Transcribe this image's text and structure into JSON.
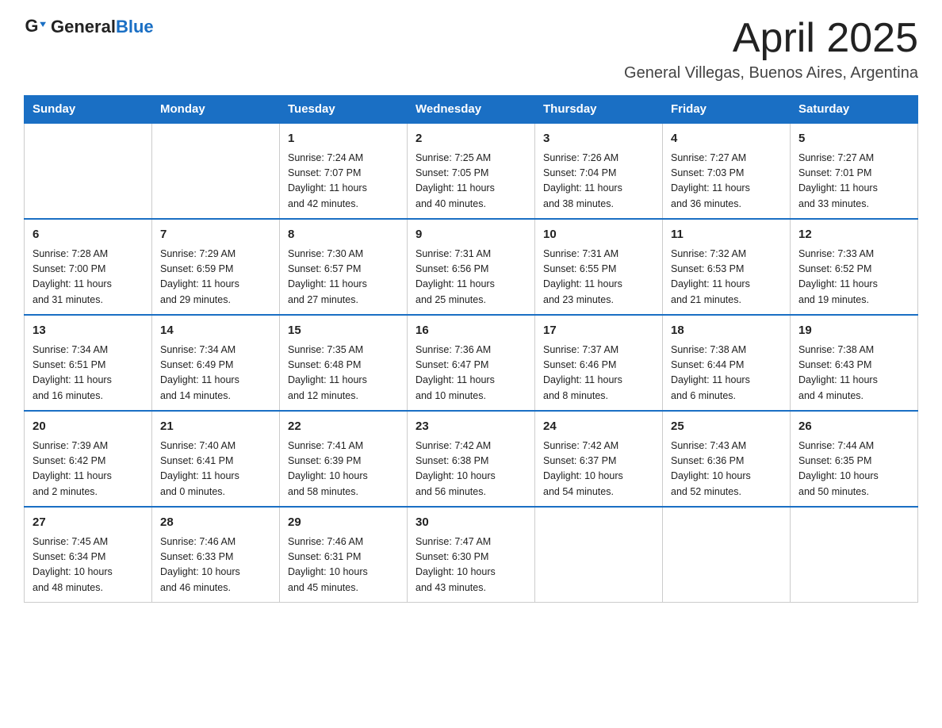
{
  "header": {
    "logo_general": "General",
    "logo_blue": "Blue",
    "month_title": "April 2025",
    "location": "General Villegas, Buenos Aires, Argentina"
  },
  "days_of_week": [
    "Sunday",
    "Monday",
    "Tuesday",
    "Wednesday",
    "Thursday",
    "Friday",
    "Saturday"
  ],
  "weeks": [
    [
      {
        "num": "",
        "detail": ""
      },
      {
        "num": "",
        "detail": ""
      },
      {
        "num": "1",
        "detail": "Sunrise: 7:24 AM\nSunset: 7:07 PM\nDaylight: 11 hours\nand 42 minutes."
      },
      {
        "num": "2",
        "detail": "Sunrise: 7:25 AM\nSunset: 7:05 PM\nDaylight: 11 hours\nand 40 minutes."
      },
      {
        "num": "3",
        "detail": "Sunrise: 7:26 AM\nSunset: 7:04 PM\nDaylight: 11 hours\nand 38 minutes."
      },
      {
        "num": "4",
        "detail": "Sunrise: 7:27 AM\nSunset: 7:03 PM\nDaylight: 11 hours\nand 36 minutes."
      },
      {
        "num": "5",
        "detail": "Sunrise: 7:27 AM\nSunset: 7:01 PM\nDaylight: 11 hours\nand 33 minutes."
      }
    ],
    [
      {
        "num": "6",
        "detail": "Sunrise: 7:28 AM\nSunset: 7:00 PM\nDaylight: 11 hours\nand 31 minutes."
      },
      {
        "num": "7",
        "detail": "Sunrise: 7:29 AM\nSunset: 6:59 PM\nDaylight: 11 hours\nand 29 minutes."
      },
      {
        "num": "8",
        "detail": "Sunrise: 7:30 AM\nSunset: 6:57 PM\nDaylight: 11 hours\nand 27 minutes."
      },
      {
        "num": "9",
        "detail": "Sunrise: 7:31 AM\nSunset: 6:56 PM\nDaylight: 11 hours\nand 25 minutes."
      },
      {
        "num": "10",
        "detail": "Sunrise: 7:31 AM\nSunset: 6:55 PM\nDaylight: 11 hours\nand 23 minutes."
      },
      {
        "num": "11",
        "detail": "Sunrise: 7:32 AM\nSunset: 6:53 PM\nDaylight: 11 hours\nand 21 minutes."
      },
      {
        "num": "12",
        "detail": "Sunrise: 7:33 AM\nSunset: 6:52 PM\nDaylight: 11 hours\nand 19 minutes."
      }
    ],
    [
      {
        "num": "13",
        "detail": "Sunrise: 7:34 AM\nSunset: 6:51 PM\nDaylight: 11 hours\nand 16 minutes."
      },
      {
        "num": "14",
        "detail": "Sunrise: 7:34 AM\nSunset: 6:49 PM\nDaylight: 11 hours\nand 14 minutes."
      },
      {
        "num": "15",
        "detail": "Sunrise: 7:35 AM\nSunset: 6:48 PM\nDaylight: 11 hours\nand 12 minutes."
      },
      {
        "num": "16",
        "detail": "Sunrise: 7:36 AM\nSunset: 6:47 PM\nDaylight: 11 hours\nand 10 minutes."
      },
      {
        "num": "17",
        "detail": "Sunrise: 7:37 AM\nSunset: 6:46 PM\nDaylight: 11 hours\nand 8 minutes."
      },
      {
        "num": "18",
        "detail": "Sunrise: 7:38 AM\nSunset: 6:44 PM\nDaylight: 11 hours\nand 6 minutes."
      },
      {
        "num": "19",
        "detail": "Sunrise: 7:38 AM\nSunset: 6:43 PM\nDaylight: 11 hours\nand 4 minutes."
      }
    ],
    [
      {
        "num": "20",
        "detail": "Sunrise: 7:39 AM\nSunset: 6:42 PM\nDaylight: 11 hours\nand 2 minutes."
      },
      {
        "num": "21",
        "detail": "Sunrise: 7:40 AM\nSunset: 6:41 PM\nDaylight: 11 hours\nand 0 minutes."
      },
      {
        "num": "22",
        "detail": "Sunrise: 7:41 AM\nSunset: 6:39 PM\nDaylight: 10 hours\nand 58 minutes."
      },
      {
        "num": "23",
        "detail": "Sunrise: 7:42 AM\nSunset: 6:38 PM\nDaylight: 10 hours\nand 56 minutes."
      },
      {
        "num": "24",
        "detail": "Sunrise: 7:42 AM\nSunset: 6:37 PM\nDaylight: 10 hours\nand 54 minutes."
      },
      {
        "num": "25",
        "detail": "Sunrise: 7:43 AM\nSunset: 6:36 PM\nDaylight: 10 hours\nand 52 minutes."
      },
      {
        "num": "26",
        "detail": "Sunrise: 7:44 AM\nSunset: 6:35 PM\nDaylight: 10 hours\nand 50 minutes."
      }
    ],
    [
      {
        "num": "27",
        "detail": "Sunrise: 7:45 AM\nSunset: 6:34 PM\nDaylight: 10 hours\nand 48 minutes."
      },
      {
        "num": "28",
        "detail": "Sunrise: 7:46 AM\nSunset: 6:33 PM\nDaylight: 10 hours\nand 46 minutes."
      },
      {
        "num": "29",
        "detail": "Sunrise: 7:46 AM\nSunset: 6:31 PM\nDaylight: 10 hours\nand 45 minutes."
      },
      {
        "num": "30",
        "detail": "Sunrise: 7:47 AM\nSunset: 6:30 PM\nDaylight: 10 hours\nand 43 minutes."
      },
      {
        "num": "",
        "detail": ""
      },
      {
        "num": "",
        "detail": ""
      },
      {
        "num": "",
        "detail": ""
      }
    ]
  ]
}
